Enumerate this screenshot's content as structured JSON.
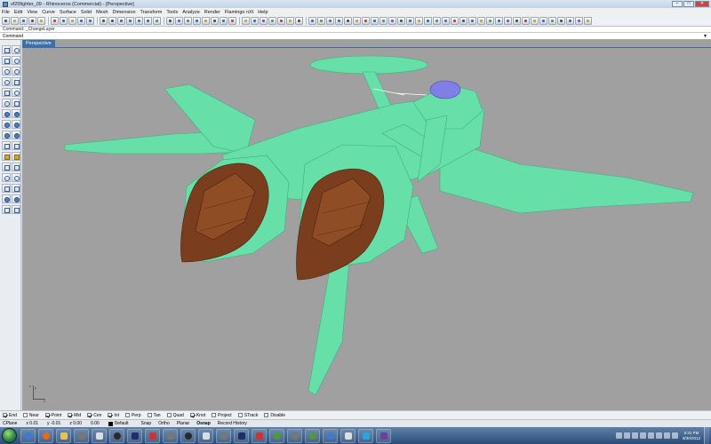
{
  "window": {
    "title": "vf25fighter_09 - Rhinoceros (Commercial) - [Perspective]",
    "buttons": [
      "–",
      "□",
      "✕"
    ]
  },
  "menu": [
    "File",
    "Edit",
    "View",
    "Curve",
    "Surface",
    "Solid",
    "Mesh",
    "Dimension",
    "Transform",
    "Tools",
    "Analyze",
    "Render",
    "Flamingo nXt",
    "Help"
  ],
  "command": {
    "history": "Command: _ChangeLayer",
    "prompt": "Command",
    "arrow": "▼"
  },
  "viewport": {
    "title": "Perspective",
    "axis_labels": {
      "x": "x",
      "y": "y",
      "z": "z"
    },
    "colors": {
      "background": "#a0a0a0",
      "body": "#66e0a8",
      "body_edge": "#3fae7c",
      "intake": "#7a3e1e",
      "canopy": "#7f7fe6"
    }
  },
  "osnap": [
    {
      "label": "End",
      "checked": true
    },
    {
      "label": "Near",
      "checked": false
    },
    {
      "label": "Point",
      "checked": true
    },
    {
      "label": "Mid",
      "checked": true
    },
    {
      "label": "Cen",
      "checked": true
    },
    {
      "label": "Int",
      "checked": true
    },
    {
      "label": "Perp",
      "checked": false
    },
    {
      "label": "Tan",
      "checked": false
    },
    {
      "label": "Quad",
      "checked": false
    },
    {
      "label": "Knot",
      "checked": true
    },
    {
      "label": "Project",
      "checked": false
    },
    {
      "label": "STrack",
      "checked": false
    },
    {
      "label": "Disable",
      "checked": false
    }
  ],
  "status": {
    "cplane": "CPlane",
    "x": "x 0.01",
    "y": "y -0.01",
    "z": "z 0.00",
    "w": "0.00",
    "layer": "Default",
    "toggles": [
      {
        "label": "Snap",
        "bold": false
      },
      {
        "label": "Ortho",
        "bold": false
      },
      {
        "label": "Planar",
        "bold": false
      },
      {
        "label": "Osnap",
        "bold": true
      },
      {
        "label": "Record History",
        "bold": false
      }
    ]
  },
  "taskbar": {
    "time": "5:31 PM",
    "date": "9/30/2012"
  }
}
